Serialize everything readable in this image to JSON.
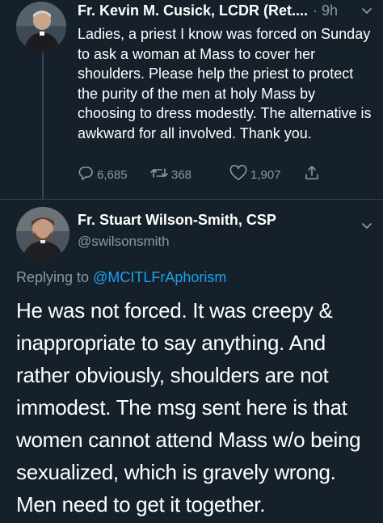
{
  "tweet1": {
    "author": "Fr. Kevin M. Cusick, LCDR (Ret....",
    "time": "· 9h",
    "text": "Ladies, a priest I know was forced on Sunday to ask a woman at Mass to cover her shoulders. Please help the priest to protect the purity of the men at holy Mass by choosing to dress modestly. The alternative is awkward for all involved. Thank you.",
    "replies": "6,685",
    "retweets": "368",
    "likes": "1,907"
  },
  "tweet2": {
    "author": "Fr. Stuart Wilson-Smith, CSP",
    "handle": "@swilsonsmith",
    "replying_prefix": "Replying to",
    "replying_to": "@MCITLFrAphorism",
    "text": "He was not forced. It was creepy & inappropriate to say anything. And rather obviously, shoulders are not immodest. The msg sent here is that women cannot attend Mass w/o being sexualized, which is gravely wrong. Men need to get it together."
  },
  "icons": {
    "reply": "reply-icon",
    "retweet": "retweet-icon",
    "like": "heart-icon",
    "share": "share-icon",
    "more": "chevron-down-icon"
  },
  "colors": {
    "background": "#15202b",
    "secondary_text": "#8899a6",
    "link": "#1da1f2",
    "divider": "#38444d"
  }
}
